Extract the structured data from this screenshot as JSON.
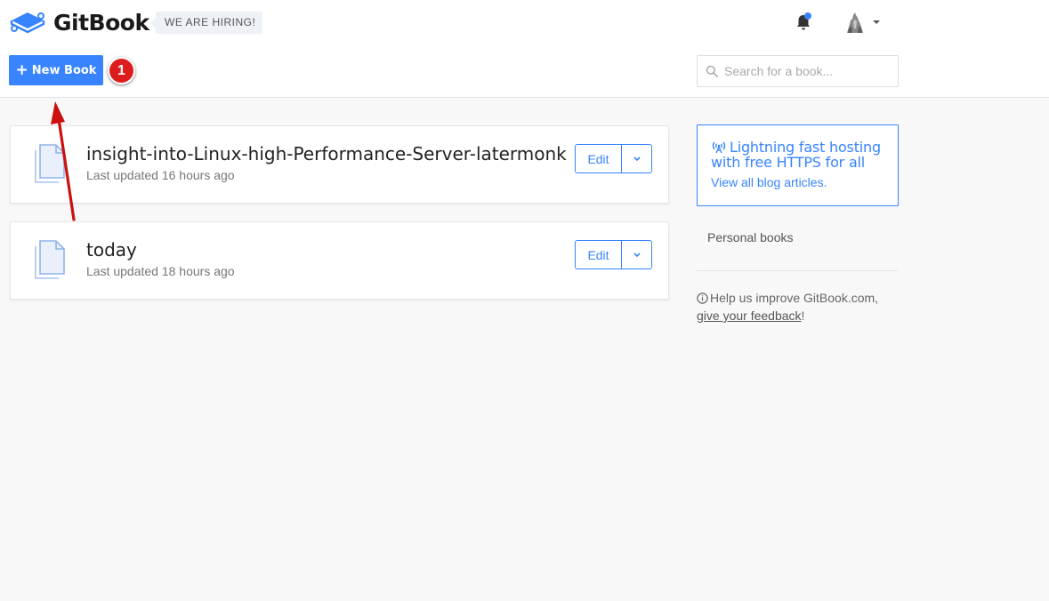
{
  "header": {
    "brand": "GitBook",
    "hiring_badge": "WE ARE HIRING!",
    "notifications_icon": "bell-icon",
    "has_unread_notifications": true,
    "accent_color": "#3884ff"
  },
  "toolbar": {
    "new_book_label": "New Book",
    "new_book_icon": "plus-icon",
    "step_marker": "1",
    "search_placeholder": "Search for a book..."
  },
  "books": [
    {
      "title": "insight-into-Linux-high-Performance-Server-latermonk",
      "updated": "Last updated 16 hours ago",
      "edit_label": "Edit"
    },
    {
      "title": "today",
      "updated": "Last updated 18 hours ago",
      "edit_label": "Edit"
    }
  ],
  "sidebar": {
    "promo_title": "Lightning fast hosting with free HTTPS for all",
    "promo_link": "View all blog articles.",
    "section_label": "Personal books",
    "help_text": "Help us improve GitBook.com,",
    "feedback_link": "give your feedback",
    "feedback_suffix": "!"
  }
}
